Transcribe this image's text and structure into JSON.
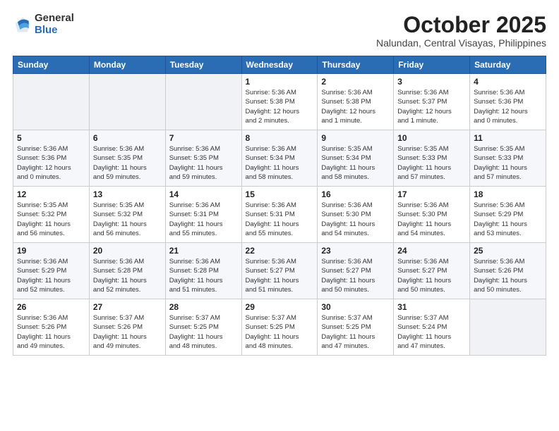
{
  "header": {
    "logo_general": "General",
    "logo_blue": "Blue",
    "month_title": "October 2025",
    "location": "Nalundan, Central Visayas, Philippines"
  },
  "days_of_week": [
    "Sunday",
    "Monday",
    "Tuesday",
    "Wednesday",
    "Thursday",
    "Friday",
    "Saturday"
  ],
  "weeks": [
    [
      {
        "day": "",
        "info": ""
      },
      {
        "day": "",
        "info": ""
      },
      {
        "day": "",
        "info": ""
      },
      {
        "day": "1",
        "info": "Sunrise: 5:36 AM\nSunset: 5:38 PM\nDaylight: 12 hours\nand 2 minutes."
      },
      {
        "day": "2",
        "info": "Sunrise: 5:36 AM\nSunset: 5:38 PM\nDaylight: 12 hours\nand 1 minute."
      },
      {
        "day": "3",
        "info": "Sunrise: 5:36 AM\nSunset: 5:37 PM\nDaylight: 12 hours\nand 1 minute."
      },
      {
        "day": "4",
        "info": "Sunrise: 5:36 AM\nSunset: 5:36 PM\nDaylight: 12 hours\nand 0 minutes."
      }
    ],
    [
      {
        "day": "5",
        "info": "Sunrise: 5:36 AM\nSunset: 5:36 PM\nDaylight: 12 hours\nand 0 minutes."
      },
      {
        "day": "6",
        "info": "Sunrise: 5:36 AM\nSunset: 5:35 PM\nDaylight: 11 hours\nand 59 minutes."
      },
      {
        "day": "7",
        "info": "Sunrise: 5:36 AM\nSunset: 5:35 PM\nDaylight: 11 hours\nand 59 minutes."
      },
      {
        "day": "8",
        "info": "Sunrise: 5:36 AM\nSunset: 5:34 PM\nDaylight: 11 hours\nand 58 minutes."
      },
      {
        "day": "9",
        "info": "Sunrise: 5:35 AM\nSunset: 5:34 PM\nDaylight: 11 hours\nand 58 minutes."
      },
      {
        "day": "10",
        "info": "Sunrise: 5:35 AM\nSunset: 5:33 PM\nDaylight: 11 hours\nand 57 minutes."
      },
      {
        "day": "11",
        "info": "Sunrise: 5:35 AM\nSunset: 5:33 PM\nDaylight: 11 hours\nand 57 minutes."
      }
    ],
    [
      {
        "day": "12",
        "info": "Sunrise: 5:35 AM\nSunset: 5:32 PM\nDaylight: 11 hours\nand 56 minutes."
      },
      {
        "day": "13",
        "info": "Sunrise: 5:35 AM\nSunset: 5:32 PM\nDaylight: 11 hours\nand 56 minutes."
      },
      {
        "day": "14",
        "info": "Sunrise: 5:36 AM\nSunset: 5:31 PM\nDaylight: 11 hours\nand 55 minutes."
      },
      {
        "day": "15",
        "info": "Sunrise: 5:36 AM\nSunset: 5:31 PM\nDaylight: 11 hours\nand 55 minutes."
      },
      {
        "day": "16",
        "info": "Sunrise: 5:36 AM\nSunset: 5:30 PM\nDaylight: 11 hours\nand 54 minutes."
      },
      {
        "day": "17",
        "info": "Sunrise: 5:36 AM\nSunset: 5:30 PM\nDaylight: 11 hours\nand 54 minutes."
      },
      {
        "day": "18",
        "info": "Sunrise: 5:36 AM\nSunset: 5:29 PM\nDaylight: 11 hours\nand 53 minutes."
      }
    ],
    [
      {
        "day": "19",
        "info": "Sunrise: 5:36 AM\nSunset: 5:29 PM\nDaylight: 11 hours\nand 52 minutes."
      },
      {
        "day": "20",
        "info": "Sunrise: 5:36 AM\nSunset: 5:28 PM\nDaylight: 11 hours\nand 52 minutes."
      },
      {
        "day": "21",
        "info": "Sunrise: 5:36 AM\nSunset: 5:28 PM\nDaylight: 11 hours\nand 51 minutes."
      },
      {
        "day": "22",
        "info": "Sunrise: 5:36 AM\nSunset: 5:27 PM\nDaylight: 11 hours\nand 51 minutes."
      },
      {
        "day": "23",
        "info": "Sunrise: 5:36 AM\nSunset: 5:27 PM\nDaylight: 11 hours\nand 50 minutes."
      },
      {
        "day": "24",
        "info": "Sunrise: 5:36 AM\nSunset: 5:27 PM\nDaylight: 11 hours\nand 50 minutes."
      },
      {
        "day": "25",
        "info": "Sunrise: 5:36 AM\nSunset: 5:26 PM\nDaylight: 11 hours\nand 50 minutes."
      }
    ],
    [
      {
        "day": "26",
        "info": "Sunrise: 5:36 AM\nSunset: 5:26 PM\nDaylight: 11 hours\nand 49 minutes."
      },
      {
        "day": "27",
        "info": "Sunrise: 5:37 AM\nSunset: 5:26 PM\nDaylight: 11 hours\nand 49 minutes."
      },
      {
        "day": "28",
        "info": "Sunrise: 5:37 AM\nSunset: 5:25 PM\nDaylight: 11 hours\nand 48 minutes."
      },
      {
        "day": "29",
        "info": "Sunrise: 5:37 AM\nSunset: 5:25 PM\nDaylight: 11 hours\nand 48 minutes."
      },
      {
        "day": "30",
        "info": "Sunrise: 5:37 AM\nSunset: 5:25 PM\nDaylight: 11 hours\nand 47 minutes."
      },
      {
        "day": "31",
        "info": "Sunrise: 5:37 AM\nSunset: 5:24 PM\nDaylight: 11 hours\nand 47 minutes."
      },
      {
        "day": "",
        "info": ""
      }
    ]
  ]
}
